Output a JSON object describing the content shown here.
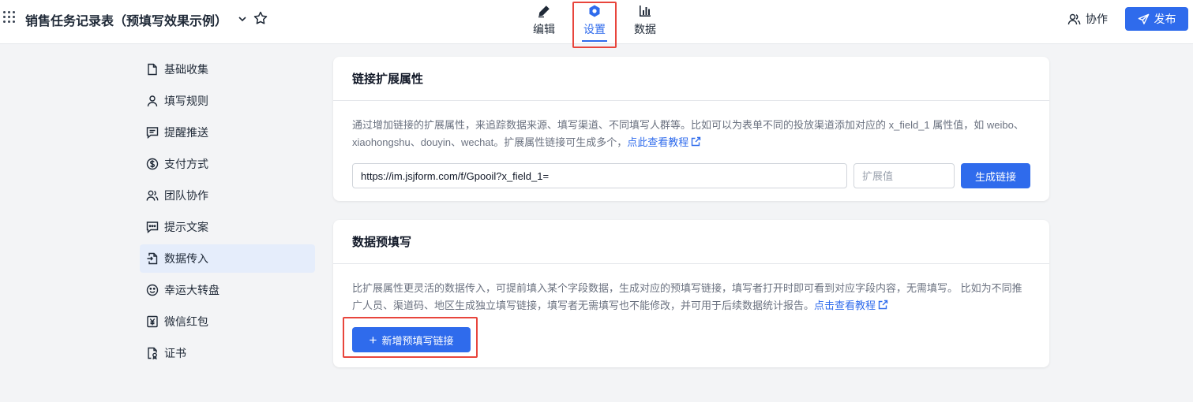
{
  "header": {
    "title": "销售任务记录表（预填写效果示例）",
    "tabs": [
      {
        "label": "编辑",
        "icon": "pen-icon"
      },
      {
        "label": "设置",
        "icon": "hexagon-settings-icon"
      },
      {
        "label": "数据",
        "icon": "bar-chart-icon"
      }
    ],
    "collab_label": "协作",
    "publish_label": "发布"
  },
  "sidebar": {
    "items": [
      {
        "label": "基础收集",
        "icon": "file-icon"
      },
      {
        "label": "填写规则",
        "icon": "user-icon"
      },
      {
        "label": "提醒推送",
        "icon": "message-icon"
      },
      {
        "label": "支付方式",
        "icon": "dollar-icon"
      },
      {
        "label": "团队协作",
        "icon": "users-icon"
      },
      {
        "label": "提示文案",
        "icon": "chat-dots-icon"
      },
      {
        "label": "数据传入",
        "icon": "file-import-icon"
      },
      {
        "label": "幸运大转盘",
        "icon": "smile-icon"
      },
      {
        "label": "微信红包",
        "icon": "yen-icon"
      },
      {
        "label": "证书",
        "icon": "certificate-icon"
      }
    ],
    "active": "数据传入"
  },
  "link_ext": {
    "title": "链接扩展属性",
    "desc": "通过增加链接的扩展属性，来追踪数据来源、填写渠道、不同填写人群等。比如可以为表单不同的投放渠道添加对应的 x_field_1 属性值，如 weibo、xiaohongshu、douyin、wechat。扩展属性链接可生成多个，",
    "link": "点此查看教程",
    "url_value": "https://im.jsjform.com/f/Gpooil?x_field_1=",
    "ext_placeholder": "扩展值",
    "gen_label": "生成链接"
  },
  "prefill": {
    "title": "数据预填写",
    "desc": "比扩展属性更灵活的数据传入，可提前填入某个字段数据，生成对应的预填写链接，填写者打开时即可看到对应字段内容，无需填写。 比如为不同推广人员、渠道码、地区生成独立填写链接，填写者无需填写也不能修改，并可用于后续数据统计报告。",
    "link": "点击查看教程",
    "add_label": "新增预填写链接"
  },
  "colors": {
    "accent": "#2f6bec",
    "highlight": "#e8453c"
  }
}
